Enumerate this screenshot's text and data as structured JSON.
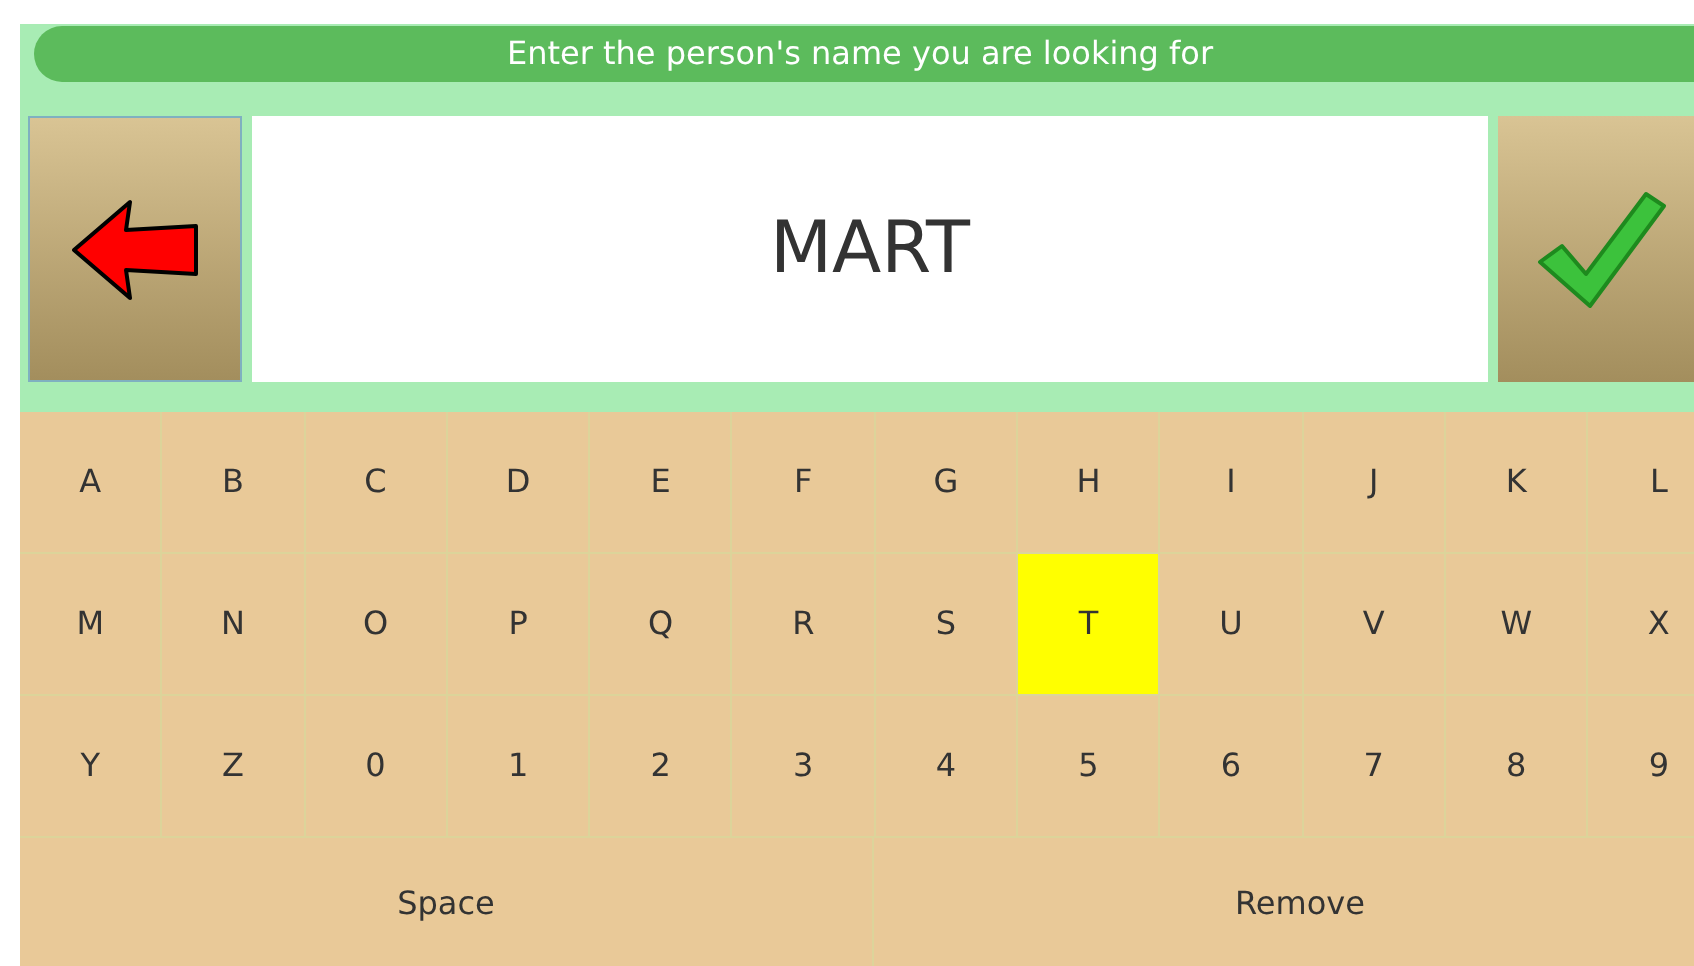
{
  "prompt": "Enter the person's name you are looking for",
  "name_field": {
    "value": "MART"
  },
  "keys": [
    [
      {
        "label": "A",
        "selected": false
      },
      {
        "label": "B",
        "selected": false
      },
      {
        "label": "C",
        "selected": false
      },
      {
        "label": "D",
        "selected": false
      },
      {
        "label": "E",
        "selected": false
      },
      {
        "label": "F",
        "selected": false
      },
      {
        "label": "G",
        "selected": false
      },
      {
        "label": "H",
        "selected": false
      },
      {
        "label": "I",
        "selected": false
      },
      {
        "label": "J",
        "selected": false
      },
      {
        "label": "K",
        "selected": false
      },
      {
        "label": "L",
        "selected": false
      }
    ],
    [
      {
        "label": "M",
        "selected": false
      },
      {
        "label": "N",
        "selected": false
      },
      {
        "label": "O",
        "selected": false
      },
      {
        "label": "P",
        "selected": false
      },
      {
        "label": "Q",
        "selected": false
      },
      {
        "label": "R",
        "selected": false
      },
      {
        "label": "S",
        "selected": false
      },
      {
        "label": "T",
        "selected": true
      },
      {
        "label": "U",
        "selected": false
      },
      {
        "label": "V",
        "selected": false
      },
      {
        "label": "W",
        "selected": false
      },
      {
        "label": "X",
        "selected": false
      }
    ],
    [
      {
        "label": "Y",
        "selected": false
      },
      {
        "label": "Z",
        "selected": false
      },
      {
        "label": "0",
        "selected": false
      },
      {
        "label": "1",
        "selected": false
      },
      {
        "label": "2",
        "selected": false
      },
      {
        "label": "3",
        "selected": false
      },
      {
        "label": "4",
        "selected": false
      },
      {
        "label": "5",
        "selected": false
      },
      {
        "label": "6",
        "selected": false
      },
      {
        "label": "7",
        "selected": false
      },
      {
        "label": "8",
        "selected": false
      },
      {
        "label": "9",
        "selected": false
      }
    ]
  ],
  "actions": [
    {
      "label": "Space"
    },
    {
      "label": "Remove"
    }
  ]
}
